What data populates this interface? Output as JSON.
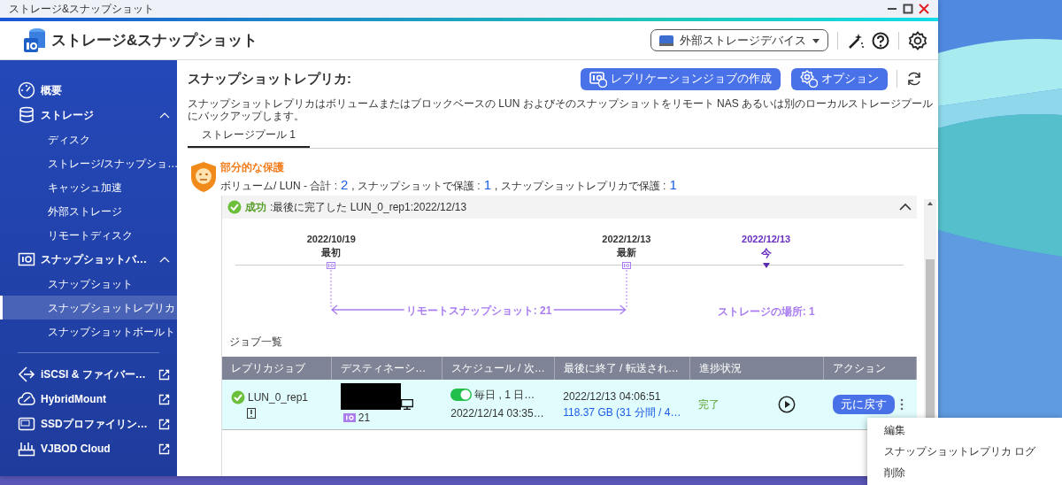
{
  "window": {
    "title": "ストレージ&スナップショット"
  },
  "app": {
    "title": "ストレージ&スナップショット",
    "device_select": "外部ストレージデバイス"
  },
  "sidebar": {
    "items": [
      {
        "label": "概要",
        "kind": "section"
      },
      {
        "label": "ストレージ",
        "kind": "section",
        "expanded": true,
        "children": [
          {
            "label": "ディスク",
            "selected": false
          },
          {
            "label": "ストレージ/スナップショ…",
            "selected": false
          },
          {
            "label": "キャッシュ加速",
            "selected": false
          },
          {
            "label": "外部ストレージ",
            "selected": false
          },
          {
            "label": "リモートディスク",
            "selected": false
          }
        ]
      },
      {
        "label": "スナップショットバ…",
        "kind": "section",
        "expanded": true,
        "children": [
          {
            "label": "スナップショット",
            "selected": false
          },
          {
            "label": "スナップショットレプリカ",
            "selected": true
          },
          {
            "label": "スナップショットボールト",
            "selected": false
          }
        ]
      },
      {
        "label": "iSCSI & ファイバー…",
        "kind": "external"
      },
      {
        "label": "HybridMount",
        "kind": "external"
      },
      {
        "label": "SSDプロファイリン…",
        "kind": "external"
      },
      {
        "label": "VJBOD Cloud",
        "kind": "external"
      }
    ]
  },
  "main": {
    "heading": "スナップショットレプリカ:",
    "buttons": [
      "レプリケーションジョブの作成",
      "オプション"
    ],
    "description": "スナップショットレプリカはボリュームまたはブロックベースの LUN およびそのスナップショットをリモート NAS あるいは別のローカルストレージプールにバックアップします。",
    "tabs": [
      {
        "label": "ストレージプール 1",
        "selected": true
      }
    ],
    "protection": {
      "status": "部分的な保護",
      "summary": [
        {
          "label": "ボリューム/ LUN - 合計 :",
          "count": "2"
        },
        {
          "label": ", スナップショットで保護 :",
          "count": "1"
        },
        {
          "label": ", スナップショットレプリカで保護 :",
          "count": "1"
        }
      ]
    },
    "result": {
      "label": "成功",
      "message": ":最後に完了した LUN_0_rep1:2022/12/13",
      "expanded": true
    },
    "timeline": {
      "points": [
        {
          "date": "2022/10/19",
          "label": "最初",
          "kind": "snapshot"
        },
        {
          "date": "2022/12/13",
          "label": "最新",
          "kind": "snapshot"
        },
        {
          "date": "2022/12/13",
          "label": "今",
          "kind": "now"
        }
      ],
      "span_label": "リモートスナップショット: 21",
      "storage_label": "ストレージの場所: 1"
    },
    "jobs": {
      "title": "ジョブ一覧",
      "columns": [
        "レプリカジョブ",
        "デスティネーシ…",
        "スケジュール / 次…",
        "最後に終了 / 転送され…",
        "進捗状況",
        "アクション"
      ],
      "rows": [
        {
          "name": "LUN_0_rep1",
          "snapshots": "21",
          "schedule_on": true,
          "schedule": "毎日 , 1 日…",
          "next_run": "2022/12/14 03:35…",
          "last_end": "2022/12/13 04:06:51",
          "transferred": "118.37 GB (31 分間 / 4…",
          "progress": "完了",
          "action": "元に戻す"
        }
      ]
    }
  },
  "context_menu": {
    "items": [
      "編集",
      "スナップショットレプリカ ログ",
      "削除"
    ]
  }
}
